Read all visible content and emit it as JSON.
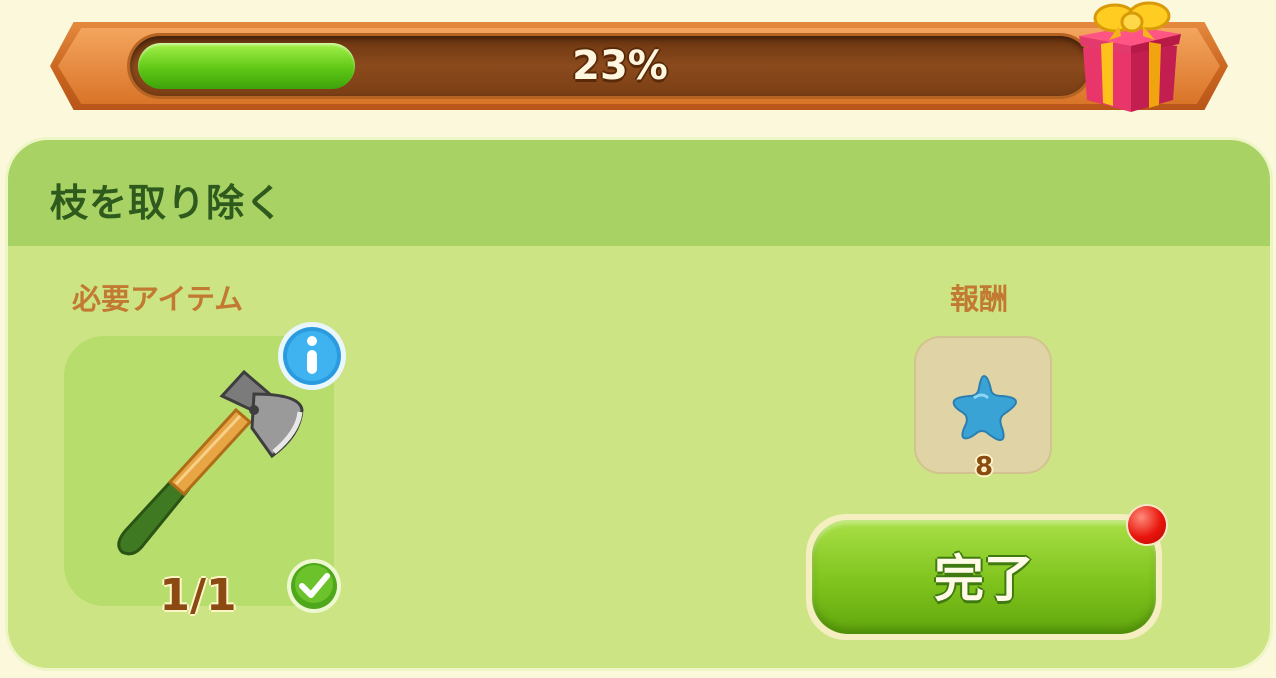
{
  "progress": {
    "percent": 23,
    "label": "23%",
    "reward_icon": "gift-box-icon"
  },
  "task": {
    "title": "枝を取り除く",
    "required_label": "必要アイテム",
    "reward_label": "報酬",
    "required_item": {
      "icon": "axe-icon",
      "count": "1/1",
      "status": "complete"
    },
    "reward": {
      "icon": "blue-star-icon",
      "amount": "8"
    },
    "complete_button": "完了"
  },
  "colors": {
    "progress_fill": "#5fc816",
    "panel": "#cde485",
    "header": "#a9d264",
    "title": "#2f5a1e",
    "label": "#c27a32",
    "button": "#7fc31d",
    "notify": "#e8140c"
  }
}
